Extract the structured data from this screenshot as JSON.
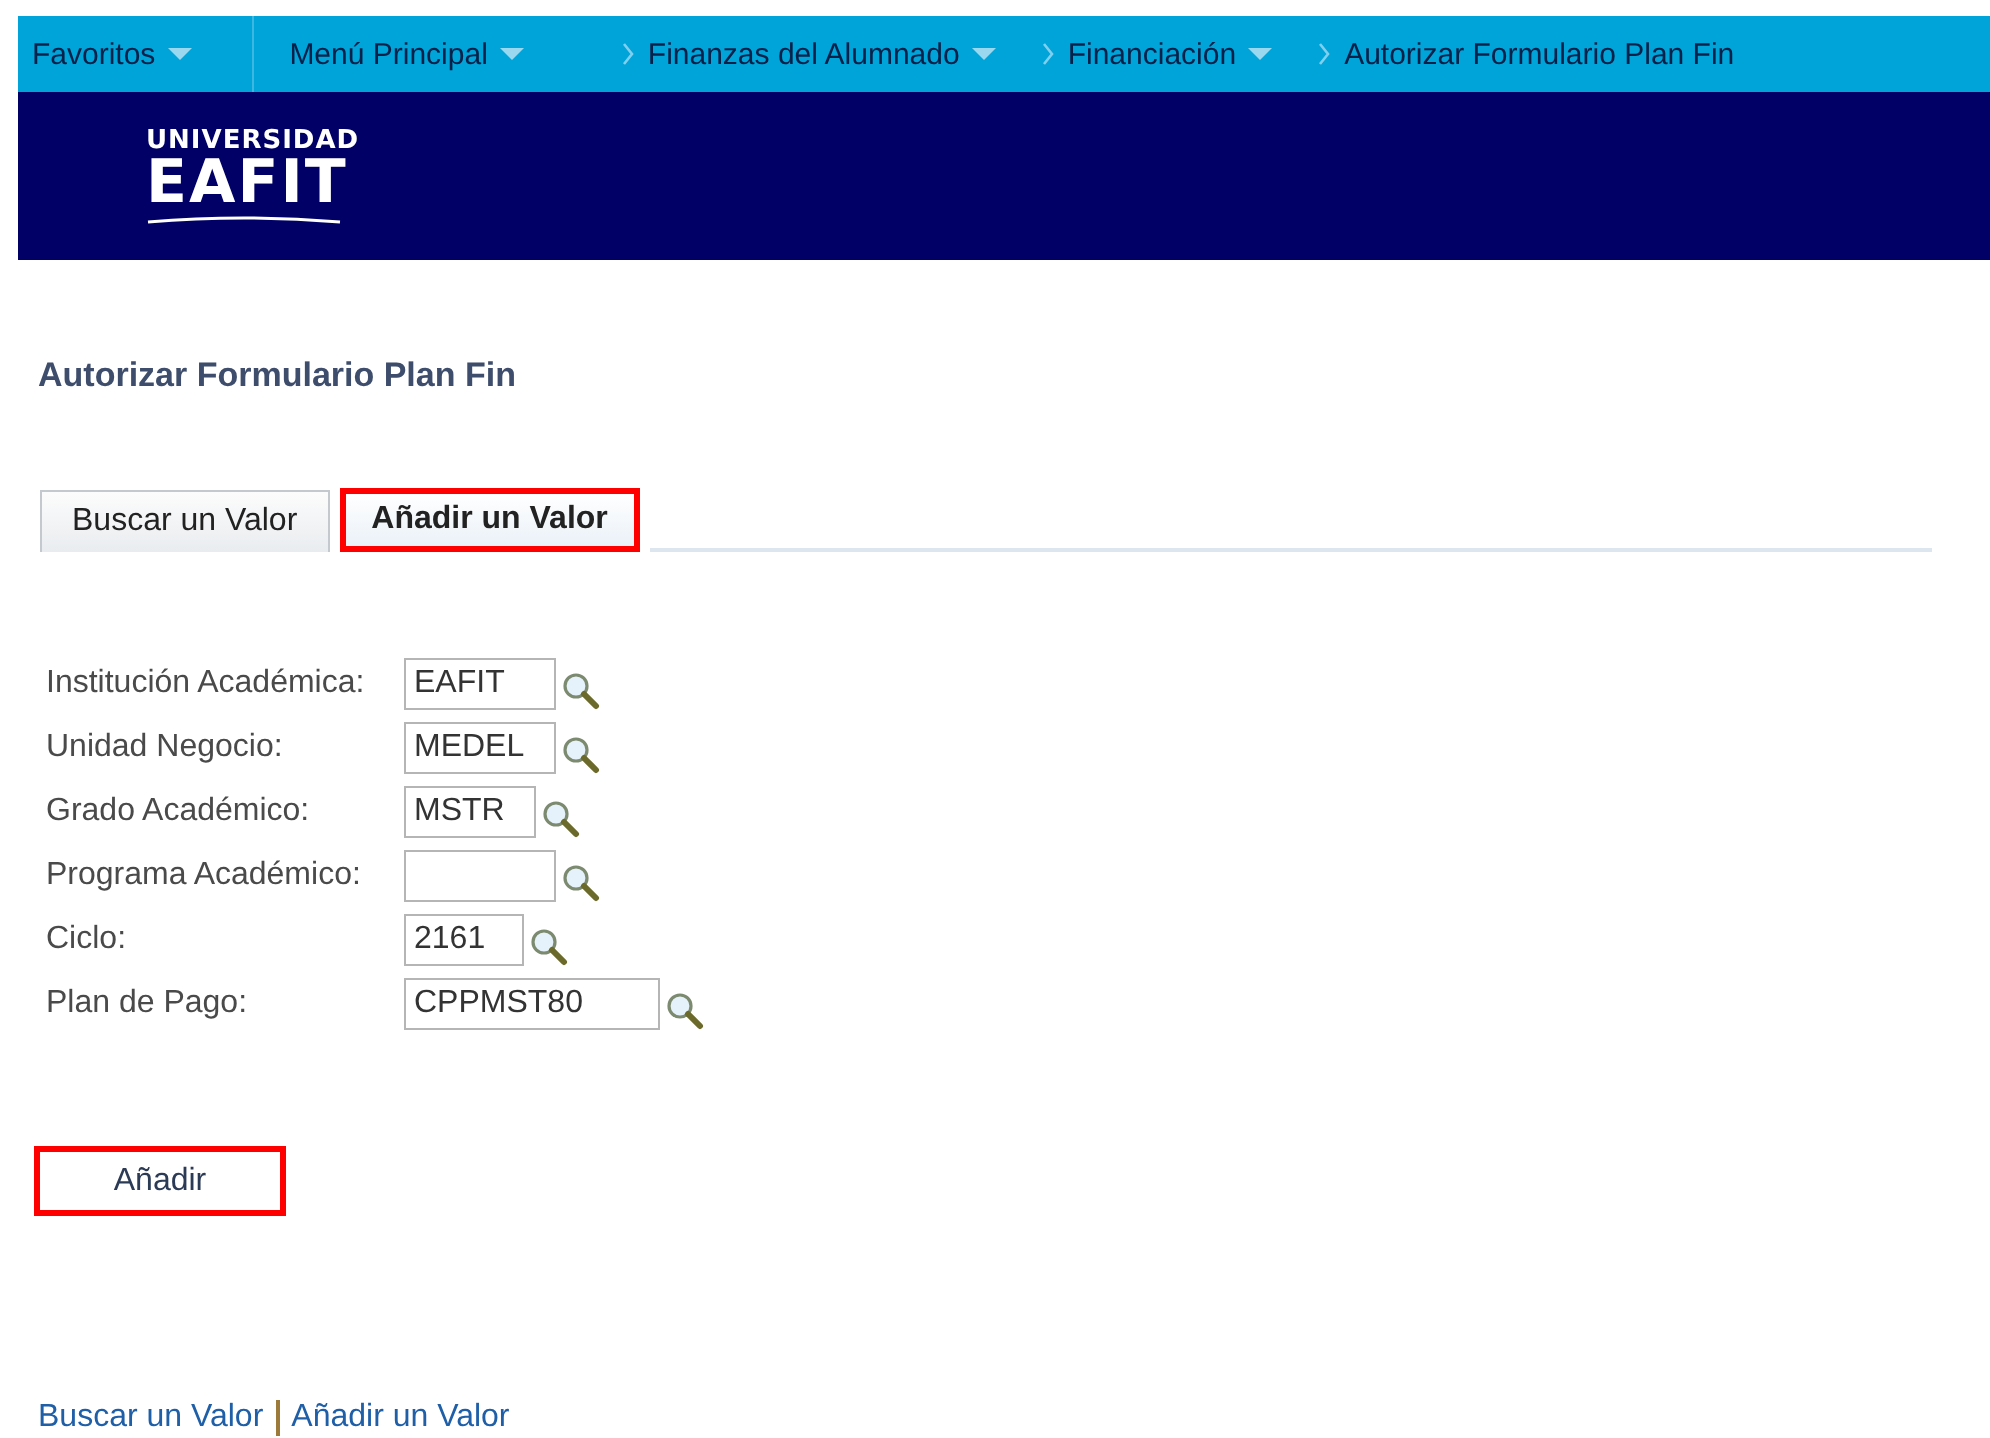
{
  "nav": {
    "items": [
      {
        "label": "Favoritos",
        "kind": "menu"
      },
      {
        "label": "Menú Principal",
        "kind": "menu"
      },
      {
        "label": "Finanzas del Alumnado",
        "kind": "crumb-menu"
      },
      {
        "label": "Financiación",
        "kind": "crumb-menu"
      },
      {
        "label": "Autorizar Formulario Plan Fin",
        "kind": "crumb"
      }
    ]
  },
  "header": {
    "logo": {
      "top": "UNIVERSIDAD",
      "main": "EAFIT"
    }
  },
  "page_title": "Autorizar Formulario Plan Fin",
  "tabs": [
    {
      "label": "Buscar un Valor",
      "selected": false,
      "highlighted": false
    },
    {
      "label": "Añadir un Valor",
      "selected": true,
      "highlighted": true
    }
  ],
  "fields": [
    {
      "label": "Institución Académica:",
      "value": "EAFIT"
    },
    {
      "label": "Unidad Negocio:",
      "value": "MEDEL"
    },
    {
      "label": "Grado Académico:",
      "value": "MSTR"
    },
    {
      "label": "Programa Académico:"
    },
    {
      "label": "Ciclo:",
      "value": "2161"
    },
    {
      "label": "Plan de Pago:",
      "value": "CPPMST80"
    }
  ],
  "add_button": {
    "label": "Añadir",
    "highlighted": true
  },
  "footer_links": [
    "Buscar un Valor",
    "Añadir un Valor"
  ]
}
